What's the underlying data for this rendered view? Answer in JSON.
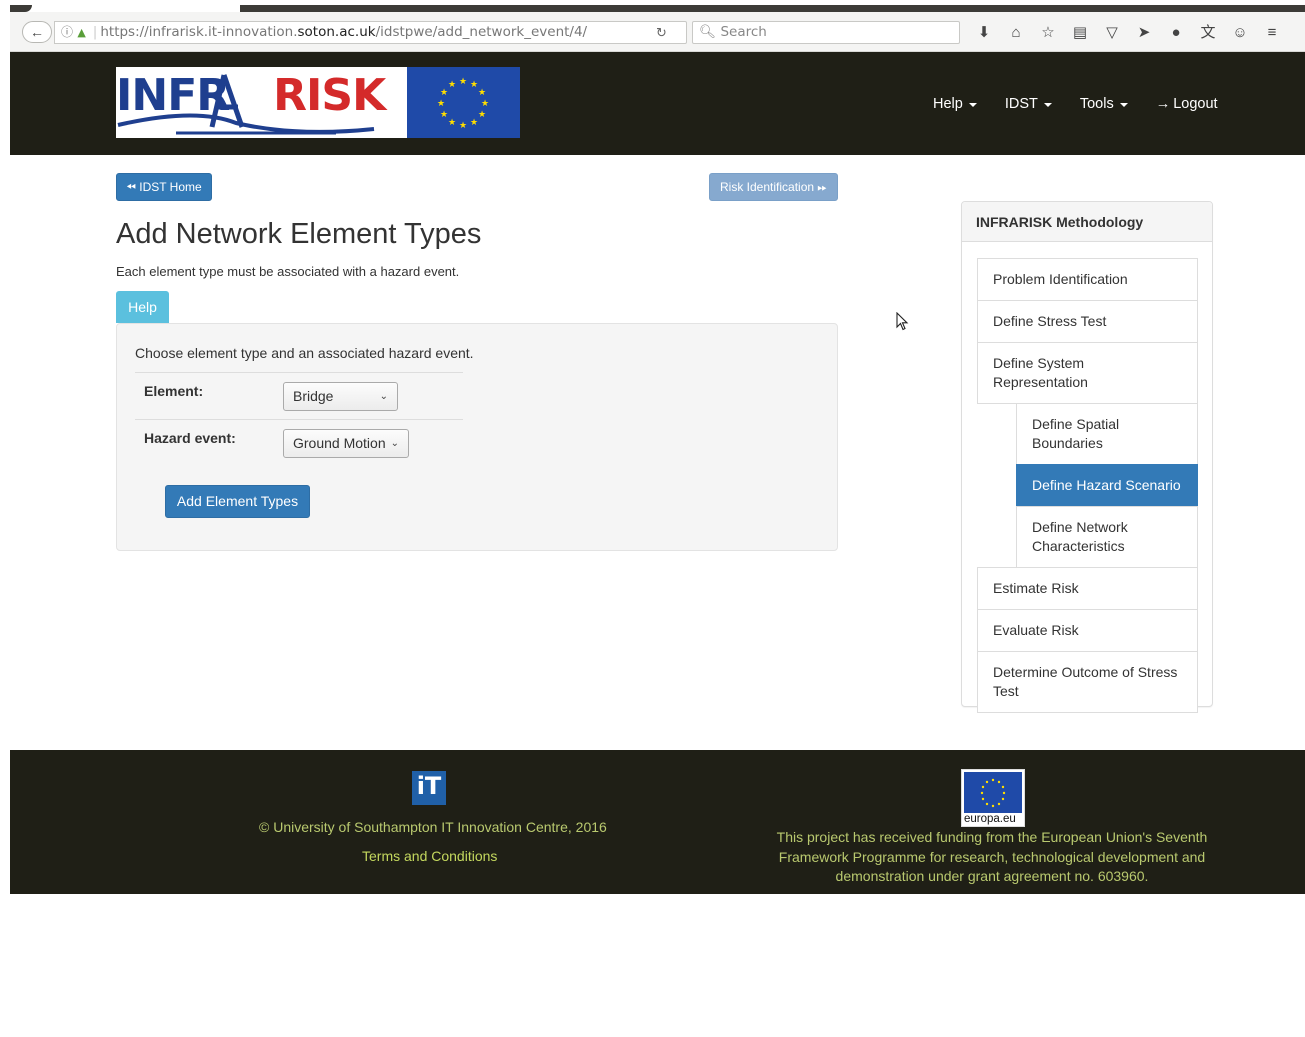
{
  "browser": {
    "url_prefix": "https://infrarisk.it-innovation.",
    "url_domain": "soton.ac.uk",
    "url_path": "/idstpwe/add_network_event/4/",
    "search_placeholder": "Search",
    "icons": [
      "download-icon",
      "home-icon",
      "bookmark-star-icon",
      "reading-list-icon",
      "pocket-icon",
      "send-icon",
      "chat-icon",
      "translate-icon",
      "account-icon",
      "menu-icon"
    ]
  },
  "header": {
    "logo_infr": "INFR",
    "logo_risk": "RISK",
    "nav": [
      {
        "label": "Help",
        "dropdown": true
      },
      {
        "label": "IDST",
        "dropdown": true
      },
      {
        "label": "Tools",
        "dropdown": true
      },
      {
        "label": "Logout",
        "icon": "logout-icon"
      }
    ]
  },
  "content": {
    "home_button": "IDST Home",
    "next_button": "Risk Identification",
    "title": "Add Network Element Types",
    "subtitle": "Each element type must be associated with a hazard event.",
    "help_button": "Help",
    "form_intro": "Choose element type and an associated hazard event.",
    "element_label": "Element:",
    "element_value": "Bridge",
    "hazard_label": "Hazard event:",
    "hazard_value": "Ground Motion",
    "submit_button": "Add Element Types"
  },
  "sidebar": {
    "heading": "INFRARISK Methodology",
    "items": [
      {
        "label": "Problem Identification"
      },
      {
        "label": "Define Stress Test"
      },
      {
        "label": "Define System Representation"
      },
      {
        "label": "Define Spatial Boundaries",
        "sub": true
      },
      {
        "label": "Define Hazard Scenario",
        "sub": true,
        "active": true
      },
      {
        "label": "Define Network Characteristics",
        "sub": true
      },
      {
        "label": "Estimate Risk"
      },
      {
        "label": "Evaluate Risk"
      },
      {
        "label": "Determine Outcome of Stress Test"
      }
    ]
  },
  "footer": {
    "it_logo": "iT",
    "copyright": "© University of Southampton IT Innovation Centre, 2016",
    "terms": "Terms and Conditions",
    "eu_caption": "europa.eu",
    "funding": "This project has received funding from the European Union's Seventh Framework Programme for research, technological development and demonstration under grant agreement no. 603960."
  },
  "colors": {
    "header_bg": "#1f1f16",
    "primary": "#337ab7",
    "info": "#5bc0de",
    "footer_text": "#b9c96f"
  }
}
